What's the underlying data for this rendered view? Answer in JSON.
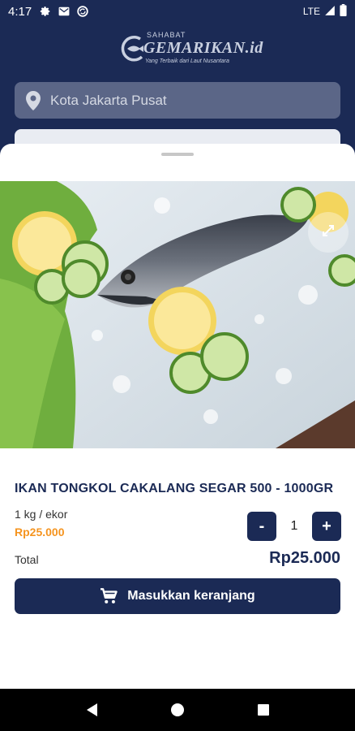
{
  "status_bar": {
    "time": "4:17",
    "network": "LTE"
  },
  "header": {
    "logo_small": "SAHABAT",
    "logo_main": "GEMARIKAN.id",
    "logo_tagline": "Yang Terbaik dari Laut Nusantara",
    "location": "Kota Jakarta Pusat"
  },
  "product": {
    "title": "IKAN TONGKOL CAKALANG SEGAR 500 - 1000GR",
    "unit": "1 kg / ekor",
    "unit_price": "Rp25.000",
    "quantity": "1",
    "minus_label": "-",
    "plus_label": "+",
    "total_label": "Total",
    "total_value": "Rp25.000",
    "add_to_cart_label": "Masukkan keranjang"
  },
  "colors": {
    "primary": "#1b2a55",
    "accent": "#f5941f"
  },
  "icons": [
    "gear-icon",
    "mail-icon",
    "sync-icon",
    "signal-icon",
    "battery-icon",
    "location-pin-icon",
    "expand-icon",
    "cart-icon",
    "back-icon",
    "home-icon",
    "recents-icon"
  ]
}
